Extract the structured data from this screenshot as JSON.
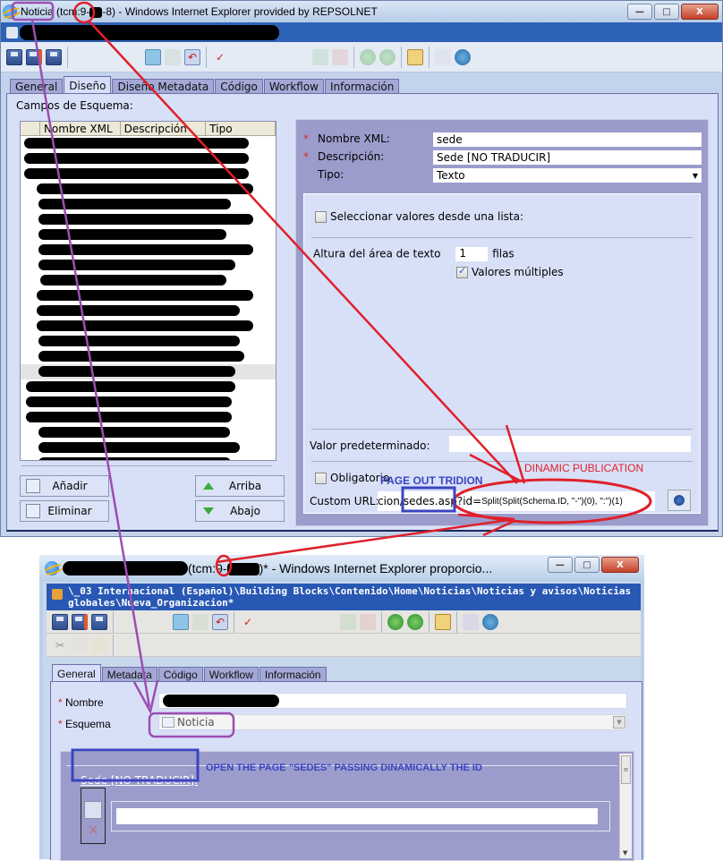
{
  "window1": {
    "title_schema": "Noticia",
    "title_rest": " (tcm:9-",
    "title_tail": "-8) - Windows Internet Explorer provided by REPSOLNET",
    "window_buttons": {
      "minimize": "—",
      "maximize": "□",
      "close": "X"
    },
    "toolbar_icons": [
      "save-icon",
      "save-close-icon",
      "save-new-icon",
      "check-in-icon",
      "check-out-icon",
      "undo-checkout-icon",
      "validate-icon",
      "localize-icon",
      "unlocalize-icon",
      "publish-icon",
      "unpublish-icon",
      "where-used-icon",
      "preview-icon",
      "refresh-icon"
    ],
    "tabs": [
      {
        "label": "General",
        "active": false
      },
      {
        "label": "Diseño",
        "active": true
      },
      {
        "label": "Diseño Metadata",
        "active": false
      },
      {
        "label": "Código",
        "active": false
      },
      {
        "label": "Workflow",
        "active": false
      },
      {
        "label": "Información",
        "active": false
      }
    ],
    "campos_label": "Campos de Esquema:",
    "tree_columns": [
      "Nombre XML",
      "Descripción",
      "Tipo"
    ],
    "buttons": {
      "add": "Añadir",
      "remove": "Eliminar",
      "up": "Arriba",
      "down": "Abajo"
    },
    "properties": {
      "nombre_xml_label": "Nombre XML:",
      "nombre_xml_value": "sede",
      "descripcion_label": "Descripción:",
      "descripcion_value": "Sede  [NO TRADUCIR]",
      "tipo_label": "Tipo:",
      "tipo_value": "Texto",
      "required_marker": "*",
      "select_from_list_label": "Seleccionar valores desde una lista:",
      "select_from_list_checked": false,
      "text_area_height_label": "Altura del área de texto",
      "text_area_height_value": "1",
      "text_area_height_unit": "filas",
      "multiple_values_label": "Valores múltiples",
      "multiple_values_checked": true,
      "default_value_label": "Valor predeterminado:",
      "default_value": "",
      "mandatory_label": "Obligatorio",
      "mandatory_checked": false,
      "custom_url_label": "Custom URL:",
      "custom_url_prefix": "cion/sedes.asp?id=",
      "custom_url_formula": "Split(Split(Schema.ID, \"-\")(0), \":\")(1)"
    }
  },
  "window2": {
    "title_middle": "(tcm:9-",
    "title_tail": ")* - Windows Internet Explorer proporcio...",
    "path": "\\_03 Internacional (Español)\\Building Blocks\\Contenido\\Home\\Noticias\\Noticias y avisos\\Noticias globales\\Nueva_Organizacion*",
    "tabs": [
      {
        "label": "General",
        "active": true
      },
      {
        "label": "Metadata",
        "active": false
      },
      {
        "label": "Código",
        "active": false
      },
      {
        "label": "Workflow",
        "active": false
      },
      {
        "label": "Información",
        "active": false
      }
    ],
    "nombre_label": "Nombre",
    "esquema_label": "Esquema",
    "esquema_value": "Noticia",
    "required_marker": "*",
    "sede_link": "Sede [NO TRADUCIR]:",
    "sede_value": ""
  },
  "annotations": {
    "page_out_tridion": "PAGE OUT TRIDION",
    "dinamic_publication": "DINAMIC PUBLICATION",
    "open_page_sedes": "OPEN THE PAGE \"SEDES\" PASSING DINAMICALLY THE ID",
    "colors": {
      "red": "#e0202a",
      "purple": "#9b4fb0",
      "blue": "#3a44c0"
    }
  }
}
